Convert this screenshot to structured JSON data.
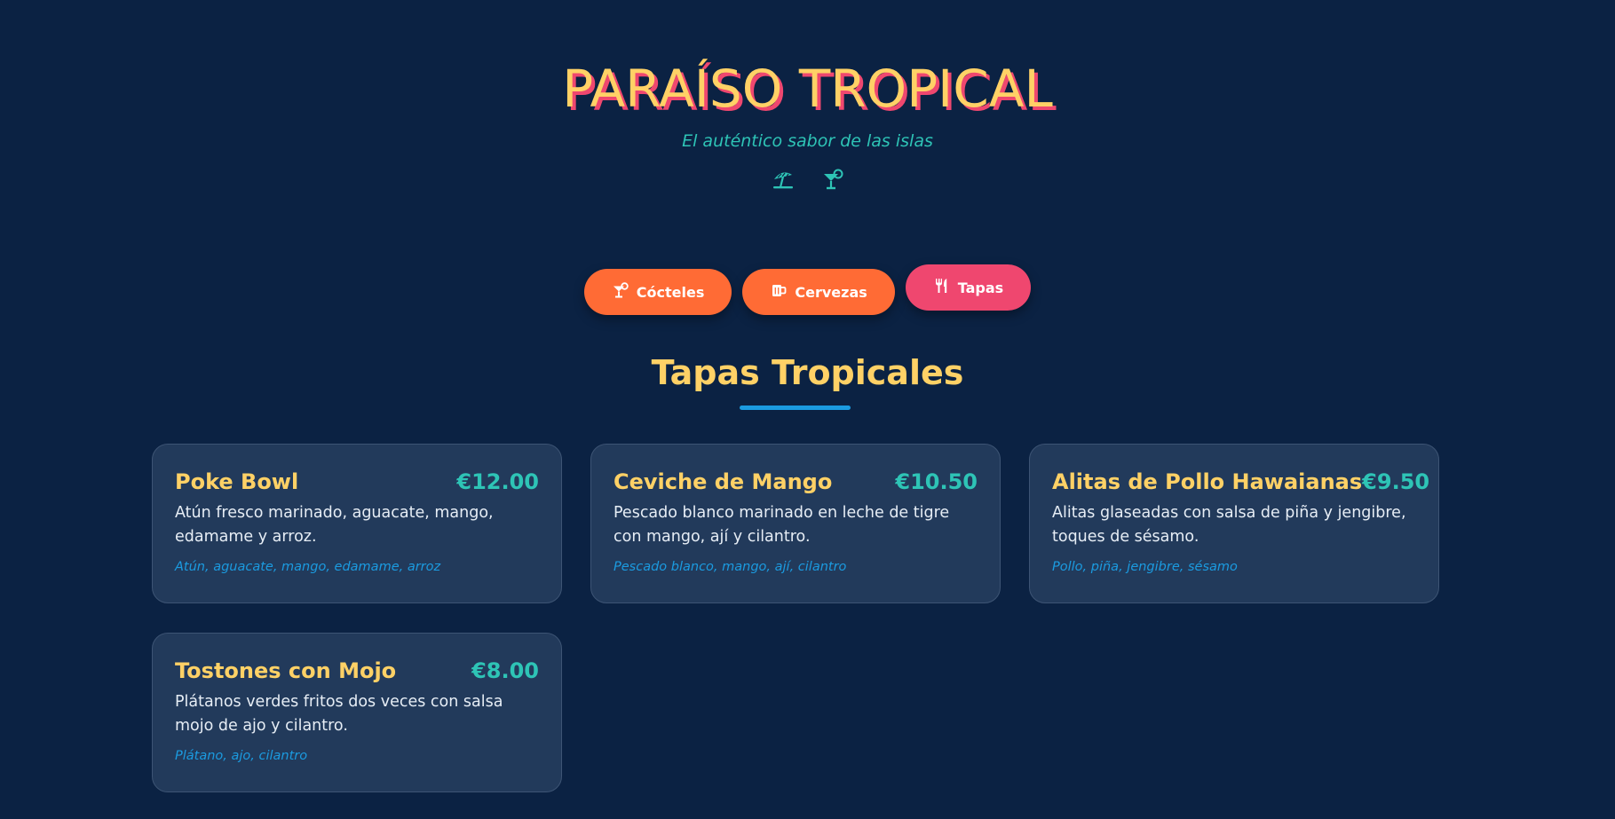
{
  "header": {
    "brand": "PARAÍSO TROPICAL",
    "tagline": "El auténtico sabor de las islas",
    "icons": [
      "umbrella-beach-icon",
      "cocktail-icon"
    ]
  },
  "tabs": [
    {
      "label": "Cócteles",
      "icon": "cocktail-icon",
      "active": false
    },
    {
      "label": "Cervezas",
      "icon": "beer-mug-icon",
      "active": false
    },
    {
      "label": "Tapas",
      "icon": "utensils-icon",
      "active": true
    }
  ],
  "section": {
    "title": "Tapas Tropicales"
  },
  "items": [
    {
      "name": "Poke Bowl",
      "price": "€12.00",
      "description": "Atún fresco marinado, aguacate, mango, edamame y arroz.",
      "ingredients": "Atún, aguacate, mango, edamame, arroz"
    },
    {
      "name": "Ceviche de Mango",
      "price": "€10.50",
      "description": "Pescado blanco marinado en leche de tigre con mango, ají y cilantro.",
      "ingredients": "Pescado blanco, mango, ají, cilantro"
    },
    {
      "name": "Alitas de Pollo Hawaianas",
      "price": "€9.50",
      "description": "Alitas glaseadas con salsa de piña y jengibre, toques de sésamo.",
      "ingredients": "Pollo, piña, jengibre, sésamo"
    },
    {
      "name": "Tostones con Mojo",
      "price": "€8.00",
      "description": "Plátanos verdes fritos dos veces con salsa mojo de ajo y cilantro.",
      "ingredients": "Plátano, ajo, cilantro"
    }
  ],
  "colors": {
    "background": "#0b2243",
    "accent_yellow": "#ffd166",
    "accent_pink": "#ef476f",
    "accent_orange": "#ff6b35",
    "accent_teal": "#2ec4b6",
    "accent_blue": "#1b9be0",
    "card": "#223a5b"
  }
}
